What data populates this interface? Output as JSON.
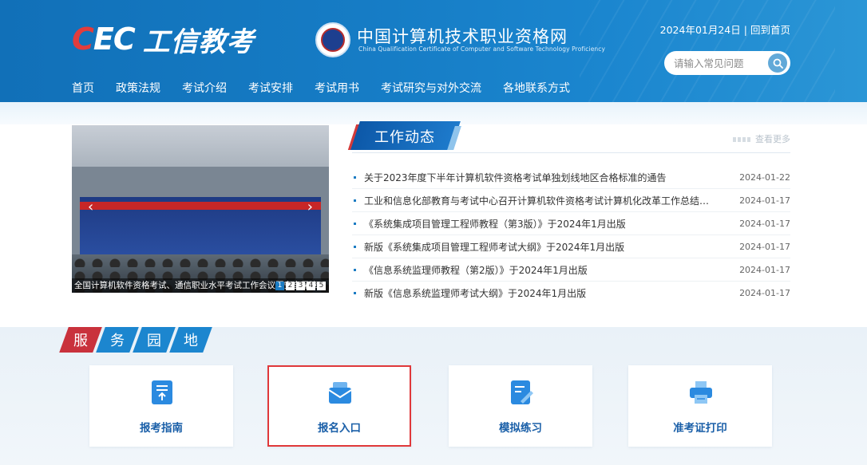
{
  "header": {
    "logo_mark_1": "C",
    "logo_mark_2": "EC",
    "logo_name": "工信教考",
    "site_title": "中国计算机技术职业资格网",
    "site_subtitle": "China Qualification Certificate of Computer and Software Technology Proficiency",
    "date": "2024年01月24日",
    "home_link": "回到首页",
    "search_placeholder": "请输入常见问题"
  },
  "nav": [
    {
      "label": "首页",
      "active": true
    },
    {
      "label": "政策法规"
    },
    {
      "label": "考试介绍"
    },
    {
      "label": "考试安排"
    },
    {
      "label": "考试用书"
    },
    {
      "label": "考试研究与对外交流"
    },
    {
      "label": "各地联系方式"
    }
  ],
  "slider": {
    "caption": "全国计算机软件资格考试、通信职业水平考试工作会议暨安全保障",
    "dots": [
      "1",
      "2",
      "3",
      "4",
      "5"
    ],
    "active_dot": 1
  },
  "news": {
    "title": "工作动态",
    "more": "查看更多",
    "items": [
      {
        "text": "关于2023年度下半年计算机软件资格考试单独划线地区合格标准的通告",
        "date": "2024-01-22"
      },
      {
        "text": "工业和信息化部教育与考试中心召开计算机软件资格考试计算机化改革工作总结座谈会",
        "date": "2024-01-17"
      },
      {
        "text": "《系统集成项目管理工程师教程（第3版）》于2024年1月出版",
        "date": "2024-01-17"
      },
      {
        "text": "新版《系统集成项目管理工程师考试大纲》于2024年1月出版",
        "date": "2024-01-17"
      },
      {
        "text": "《信息系统监理师教程（第2版）》于2024年1月出版",
        "date": "2024-01-17"
      },
      {
        "text": "新版《信息系统监理师考试大纲》于2024年1月出版",
        "date": "2024-01-17"
      }
    ]
  },
  "service": {
    "title_chars": [
      "服",
      "务",
      "园",
      "地"
    ],
    "cards": [
      {
        "label": "报考指南",
        "icon": "guide-icon"
      },
      {
        "label": "报名入口",
        "icon": "registration-icon",
        "selected": true
      },
      {
        "label": "模拟练习",
        "icon": "practice-icon"
      },
      {
        "label": "准考证打印",
        "icon": "printer-icon"
      }
    ]
  },
  "colors": {
    "header_blue": "#167dc6",
    "accent_red": "#e23c3c",
    "card_label_blue": "#1a5fa8"
  }
}
